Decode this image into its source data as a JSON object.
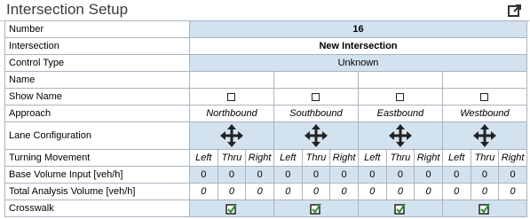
{
  "header": {
    "title": "Intersection Setup",
    "popout_icon": "popout-icon"
  },
  "rows": {
    "number": {
      "label": "Number",
      "value": "16"
    },
    "intersection": {
      "label": "Intersection",
      "value": "New Intersection"
    },
    "control_type": {
      "label": "Control Type",
      "value": "Unknown"
    },
    "name": {
      "label": "Name",
      "value": ""
    },
    "show_name": {
      "label": "Show Name",
      "checked": [
        false,
        false,
        false,
        false
      ]
    },
    "approach": {
      "label": "Approach",
      "values": [
        "Northbound",
        "Southbound",
        "Eastbound",
        "Westbound"
      ]
    },
    "lane_config": {
      "label": "Lane Configuration",
      "icon": "four-way-arrows-icon"
    },
    "turning": {
      "label": "Turning Movement",
      "movements": [
        "Left",
        "Thru",
        "Right"
      ]
    },
    "base_volume": {
      "label": "Base Volume Input [veh/h]",
      "values": [
        [
          "0",
          "0",
          "0"
        ],
        [
          "0",
          "0",
          "0"
        ],
        [
          "0",
          "0",
          "0"
        ],
        [
          "0",
          "0",
          "0"
        ]
      ]
    },
    "total_volume": {
      "label": "Total Analysis Volume [veh/h]",
      "values": [
        [
          "0",
          "0",
          "0"
        ],
        [
          "0",
          "0",
          "0"
        ],
        [
          "0",
          "0",
          "0"
        ],
        [
          "0",
          "0",
          "0"
        ]
      ]
    },
    "crosswalk": {
      "label": "Crosswalk",
      "checked": [
        true,
        true,
        true,
        true
      ]
    }
  },
  "colors": {
    "cell_blue": "#d3e2ef",
    "grid_border": "#a9b4c0",
    "check_green": "#2e8b2e"
  }
}
